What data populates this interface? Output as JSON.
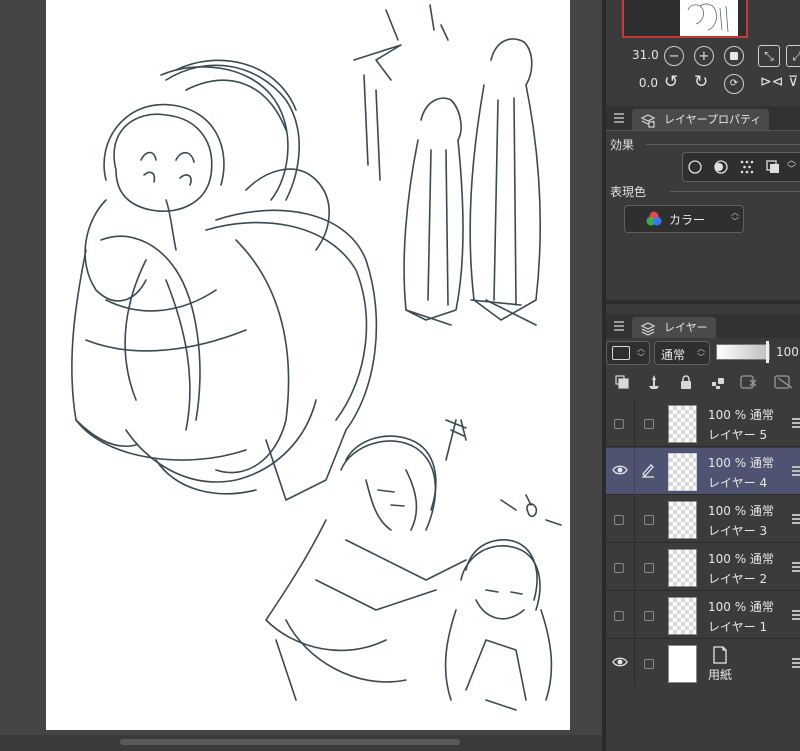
{
  "nav_controls": {
    "zoom_value": "31.0",
    "rotate_value": "0.0"
  },
  "layer_property_panel": {
    "tab_label": "レイヤープロパティ",
    "effect_label": "効果",
    "expression_color_label": "表現色",
    "expression_color_value": "カラー"
  },
  "layer_panel": {
    "tab_label": "レイヤー",
    "blend_mode": "通常",
    "opacity": "100",
    "layers": [
      {
        "blend": "100 % 通常",
        "name": "レイヤー 5",
        "visible": false,
        "selected": false
      },
      {
        "blend": "100 % 通常",
        "name": "レイヤー 4",
        "visible": true,
        "selected": true
      },
      {
        "blend": "100 % 通常",
        "name": "レイヤー 3",
        "visible": false,
        "selected": false
      },
      {
        "blend": "100 % 通常",
        "name": "レイヤー 2",
        "visible": false,
        "selected": false
      },
      {
        "blend": "100 % 通常",
        "name": "レイヤー 1",
        "visible": false,
        "selected": false
      },
      {
        "blend": "",
        "name": "用紙",
        "visible": true,
        "selected": false
      }
    ]
  },
  "colors": {
    "selected_layer_bg": "#4d5370",
    "panel_bg": "#3b3b3b",
    "sketch_stroke": "#3a4a52",
    "nav_frame": "#c43a3a"
  }
}
